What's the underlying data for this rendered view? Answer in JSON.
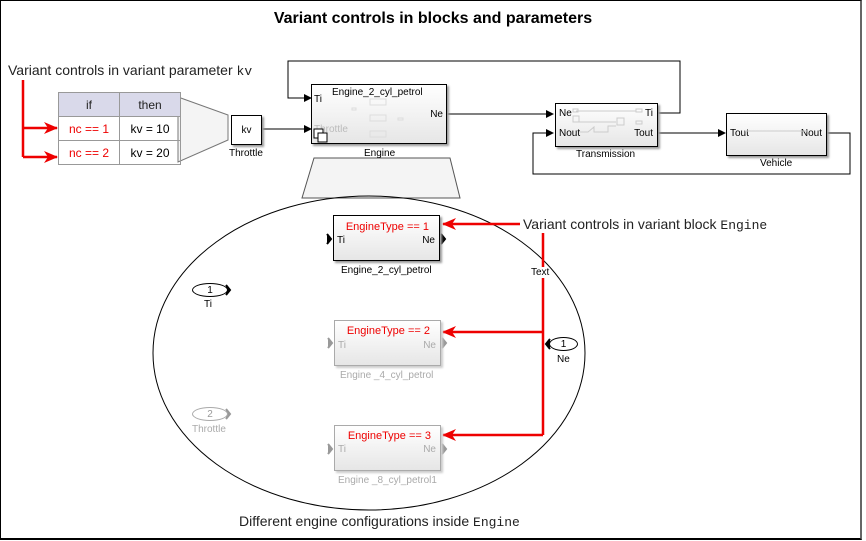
{
  "title": "Variant controls in blocks and parameters",
  "annotations": {
    "param_note_prefix": "Variant controls in variant parameter ",
    "param_note_code": "kv",
    "block_note_prefix": "Variant controls in variant block ",
    "block_note_code": "Engine",
    "bottom_note_prefix": "Different engine configurations inside ",
    "bottom_note_code": "Engine",
    "text_label": "Text"
  },
  "variant_table": {
    "headers": [
      "if",
      "then"
    ],
    "rows": [
      {
        "condition": "nc == 1",
        "value": "kv = 10"
      },
      {
        "condition": "nc == 2",
        "value": "kv = 20"
      }
    ]
  },
  "top_model": {
    "throttle_block": {
      "content": "kv",
      "label": "Throttle"
    },
    "engine_block": {
      "title": "Engine_2_cyl_petrol",
      "label": "Engine",
      "ports_in": [
        "Ti",
        "Throttle"
      ],
      "ports_out": [
        "Ne"
      ]
    },
    "transmission_block": {
      "label": "Transmission",
      "ports_in": [
        "Ne",
        "Nout"
      ],
      "ports_out": [
        "Ti",
        "Tout"
      ]
    },
    "vehicle_block": {
      "label": "Vehicle",
      "ports_in": [
        "Tout"
      ],
      "ports_out": [
        "Nout"
      ]
    }
  },
  "inside_engine": {
    "inports": [
      {
        "number": "1",
        "label": "Ti",
        "active": true
      },
      {
        "number": "2",
        "label": "Throttle",
        "active": false
      }
    ],
    "outports": [
      {
        "number": "1",
        "label": "Ne"
      }
    ],
    "variants": [
      {
        "condition": "EngineType == 1",
        "name": "Engine_2_cyl_petrol",
        "port_in": "Ti",
        "port_out": "Ne",
        "active": true
      },
      {
        "condition": "EngineType == 2",
        "name": "Engine _4_cyl_petrol",
        "port_in": "Ti",
        "port_out": "Ne",
        "active": false
      },
      {
        "condition": "EngineType == 3",
        "name": "Engine _8_cyl_petrol1",
        "port_in": "Ti",
        "port_out": "Ne",
        "active": false
      }
    ]
  },
  "colors": {
    "variant_red": "#ee0000",
    "table_header": "#d9d9ea",
    "inactive_gray": "#aaaaaa"
  }
}
